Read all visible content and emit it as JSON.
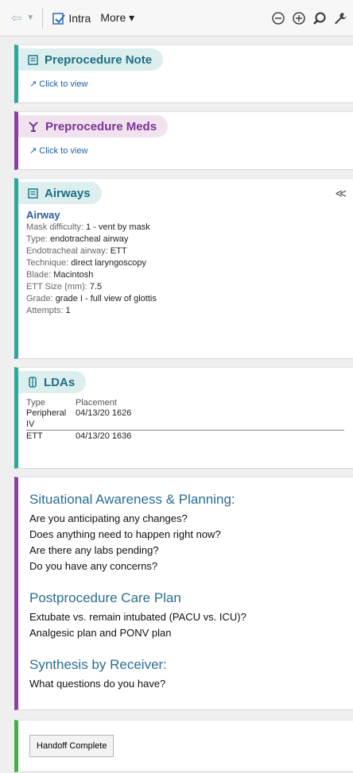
{
  "toolbar": {
    "intra_label": "Intra",
    "more_label": "More ▾",
    "icons": [
      "back-arrow-icon",
      "zoom-out-icon",
      "zoom-in-icon",
      "search-icon",
      "wrench-icon"
    ]
  },
  "preprocedure_note": {
    "title": "Preprocedure Note",
    "link": "Click to view"
  },
  "preprocedure_meds": {
    "title": "Preprocedure Meds",
    "link": "Click to view"
  },
  "airways": {
    "title": "Airways",
    "section_title": "Airway",
    "items": [
      {
        "k": "Mask difficulty: ",
        "v": "1 - vent by mask"
      },
      {
        "k": "Type: ",
        "v": "endotracheal airway"
      },
      {
        "k": "Endotracheal airway: ",
        "v": "ETT"
      },
      {
        "k": "Technique: ",
        "v": "direct laryngoscopy"
      },
      {
        "k": "Blade: ",
        "v": "Macintosh"
      },
      {
        "k": "ETT Size (mm): ",
        "v": "7.5"
      },
      {
        "k": "Grade: ",
        "v": "grade I - full view of glottis"
      },
      {
        "k": "Attempts: ",
        "v": "1"
      }
    ]
  },
  "ldas": {
    "title": "LDAs",
    "headers": [
      "Type",
      "Placement"
    ],
    "rows": [
      {
        "type": "Peripheral IV",
        "placement": "04/13/20 1626"
      },
      {
        "type": "ETT",
        "placement": "04/13/20 1636"
      }
    ]
  },
  "situational": {
    "heading1": "Situational Awareness & Planning:",
    "lines1": [
      "Are you anticipating any changes?",
      "Does anything need to happen right now?",
      "Are there any labs pending?",
      "Do you have any concerns?"
    ],
    "heading2": "Postprocedure Care Plan",
    "lines2": [
      "Extubate vs. remain intubated (PACU vs. ICU)?",
      "Analgesic plan and PONV plan"
    ],
    "heading3": "Synthesis by Receiver:",
    "lines3": [
      "What questions do you have?"
    ]
  },
  "handoff": {
    "button": "Handoff Complete"
  },
  "colors": {
    "teal": "#2aa89a",
    "purple": "#8a3ea6",
    "green": "#44ad46",
    "heading_blue": "#2a6e93"
  }
}
